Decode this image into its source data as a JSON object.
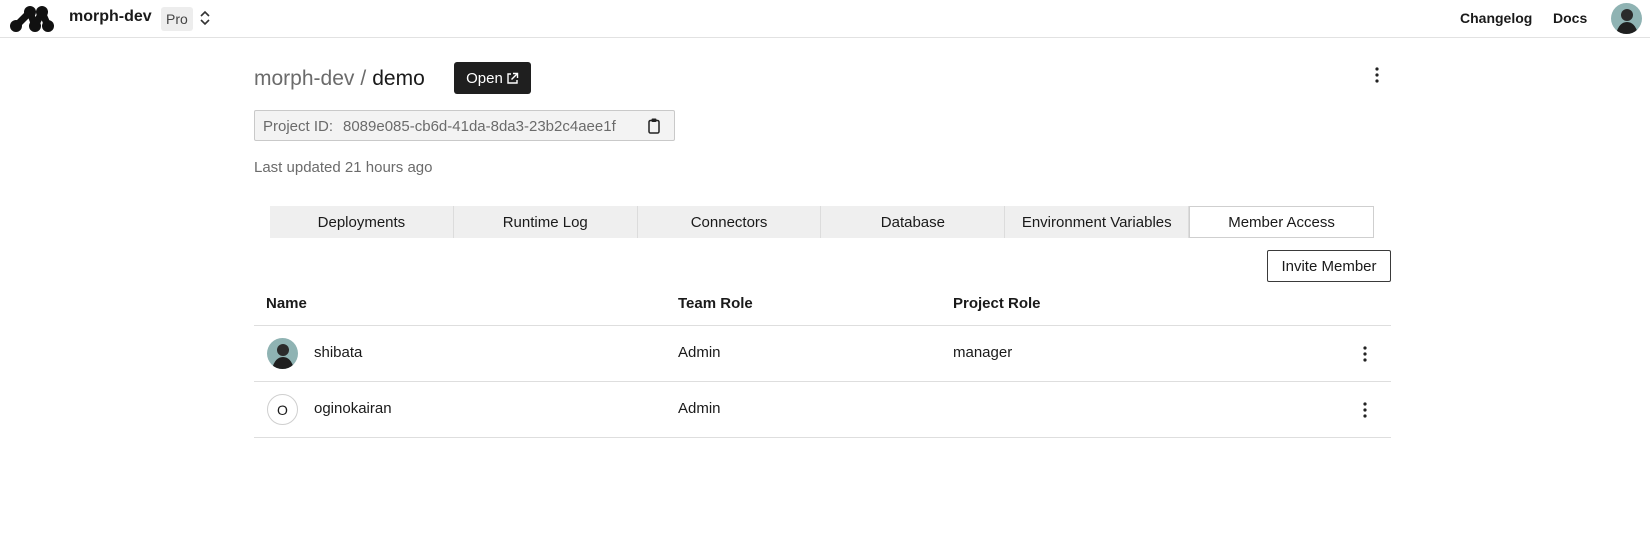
{
  "topbar": {
    "team_name": "morph-dev",
    "plan": "Pro",
    "links": {
      "changelog": "Changelog",
      "docs": "Docs"
    }
  },
  "header": {
    "team": "morph-dev",
    "separator": "/",
    "project": "demo",
    "open_label": "Open",
    "project_id_label": "Project ID:",
    "project_id": "8089e085-cb6d-41da-8da3-23b2c4aee1f",
    "last_updated": "Last updated 21 hours ago"
  },
  "tabs": [
    {
      "label": "Deployments",
      "active": false
    },
    {
      "label": "Runtime Log",
      "active": false
    },
    {
      "label": "Connectors",
      "active": false
    },
    {
      "label": "Database",
      "active": false
    },
    {
      "label": "Environment Variables",
      "active": false
    },
    {
      "label": "Member Access",
      "active": true
    }
  ],
  "invite_label": "Invite Member",
  "table": {
    "headers": {
      "name": "Name",
      "team_role": "Team Role",
      "project_role": "Project Role"
    },
    "rows": [
      {
        "name": "shibata",
        "avatar": "photo",
        "team_role": "Admin",
        "project_role": "manager"
      },
      {
        "name": "oginokairan",
        "avatar": "initial",
        "initial": "O",
        "team_role": "Admin",
        "project_role": ""
      }
    ]
  },
  "icons": {
    "logo": "morph-logo-icon",
    "switcher": "chevron-up-down-icon",
    "open": "external-link-icon",
    "more": "more-vertical-icon",
    "copy": "clipboard-icon"
  },
  "colors": {
    "primary_button": "#1f1f1f",
    "muted_text": "#6b6b6b",
    "tab_bg": "#efefef"
  }
}
